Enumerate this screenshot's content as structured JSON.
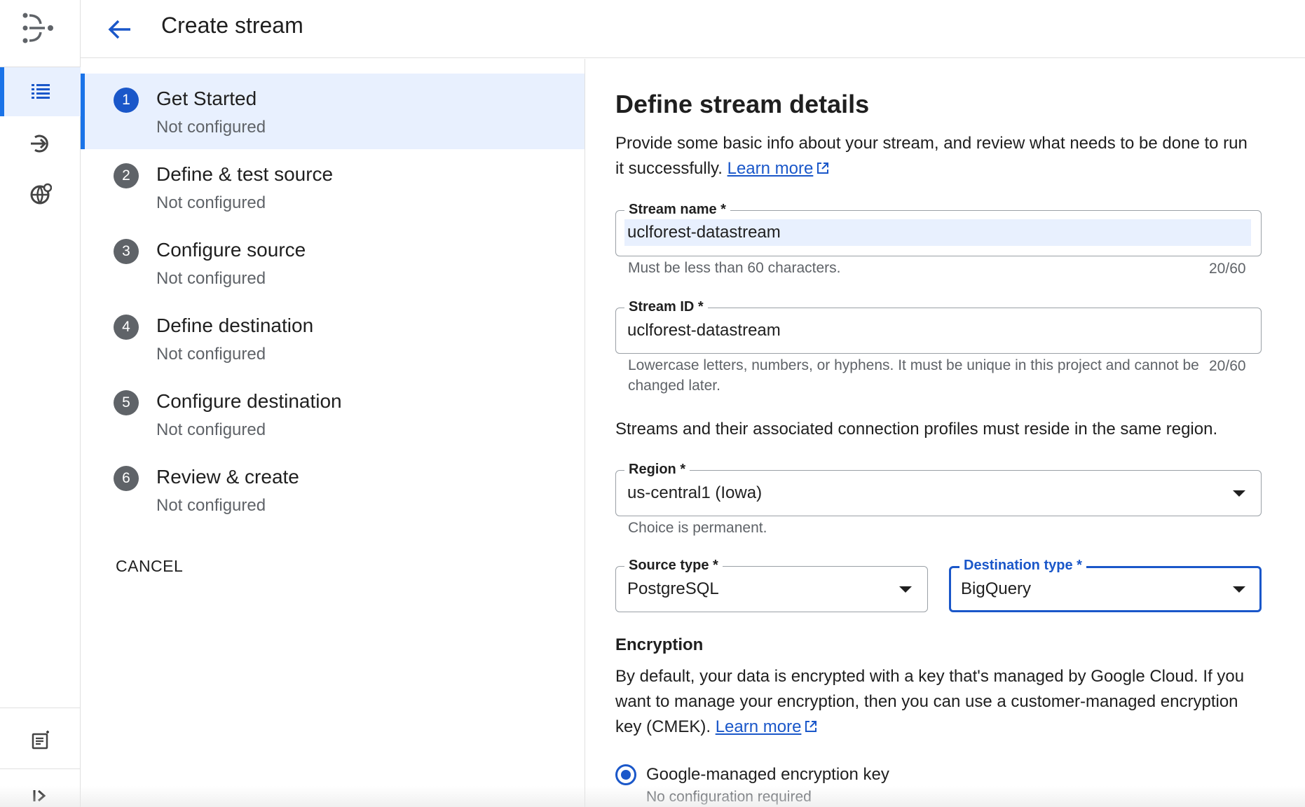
{
  "header": {
    "title": "Create stream"
  },
  "steps": [
    {
      "number": "1",
      "title": "Get Started",
      "status": "Not configured"
    },
    {
      "number": "2",
      "title": "Define & test source",
      "status": "Not configured"
    },
    {
      "number": "3",
      "title": "Configure source",
      "status": "Not configured"
    },
    {
      "number": "4",
      "title": "Define destination",
      "status": "Not configured"
    },
    {
      "number": "5",
      "title": "Configure destination",
      "status": "Not configured"
    },
    {
      "number": "6",
      "title": "Review & create",
      "status": "Not configured"
    }
  ],
  "cancel_label": "CANCEL",
  "form": {
    "title": "Define stream details",
    "intro_text": "Provide some basic info about your stream, and review what needs to be done to run it successfully.",
    "learn_more": "Learn more",
    "stream_name": {
      "label": "Stream name *",
      "value": "uclforest-datastream",
      "hint": "Must be less than 60 characters.",
      "counter": "20/60"
    },
    "stream_id": {
      "label": "Stream ID *",
      "value": "uclforest-datastream",
      "hint": "Lowercase letters, numbers, or hyphens. It must be unique in this project and cannot be changed later.",
      "counter": "20/60"
    },
    "region_note": "Streams and their associated connection profiles must reside in the same region.",
    "region": {
      "label": "Region *",
      "value": "us-central1 (Iowa)",
      "hint": "Choice is permanent."
    },
    "source_type": {
      "label": "Source type *",
      "value": "PostgreSQL"
    },
    "destination_type": {
      "label": "Destination type *",
      "value": "BigQuery"
    },
    "encryption": {
      "title": "Encryption",
      "text": "By default, your data is encrypted with a key that's managed by Google Cloud. If you want to manage your encryption, then you can use a customer-managed encryption key (CMEK).",
      "learn_more": "Learn more",
      "option_label": "Google-managed encryption key",
      "option_sub": "No configuration required"
    }
  },
  "icons": {
    "logo": "datastream-logo-icon",
    "rail": [
      "list-icon",
      "stream-icon",
      "globe-settings-icon",
      "release-notes-icon",
      "expand-rail-icon"
    ]
  },
  "colors": {
    "accent": "#1a57c9",
    "active_bg": "#e8f0fe"
  }
}
